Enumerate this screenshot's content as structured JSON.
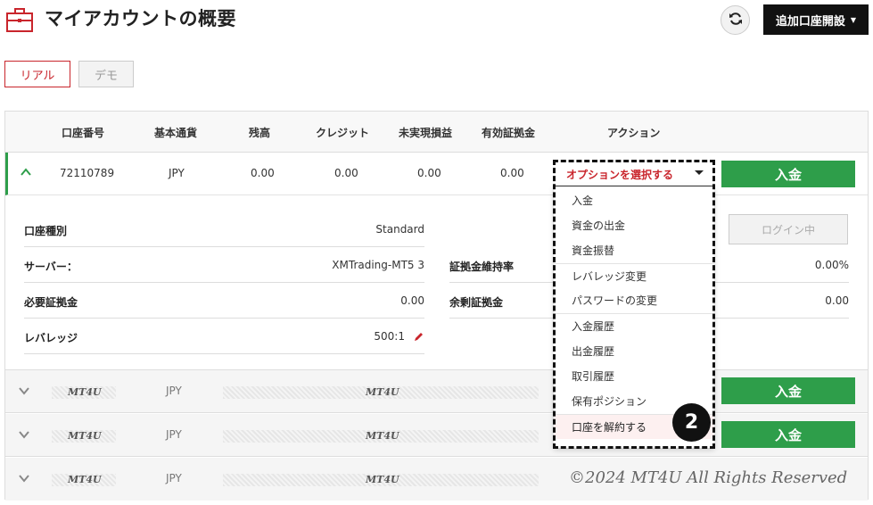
{
  "header": {
    "title": "マイアカウントの概要",
    "add_account_label": "追加口座開設",
    "colors": {
      "accent_red": "#c9252c",
      "dark": "#111111",
      "green": "#2e9e4a"
    }
  },
  "mode_tabs": [
    {
      "label": "リアル",
      "active": true
    },
    {
      "label": "デモ",
      "active": false
    }
  ],
  "table": {
    "columns": [
      "口座番号",
      "基本通貨",
      "残高",
      "クレジット",
      "未実現損益",
      "有効証拠金",
      "アクション"
    ],
    "main_row": {
      "account_number": "72110789",
      "currency": "JPY",
      "balance": "0.00",
      "credit": "0.00",
      "unrealized_pl": "0.00",
      "equity": "0.00",
      "action_select": "オプションを選択する",
      "deposit_label": "入金"
    },
    "details": {
      "account_type_label": "口座種別",
      "account_type_value": "Standard",
      "server_label": "サーバー：",
      "server_value": "XMTrading-MT5 3",
      "required_margin_label": "必要証拠金",
      "required_margin_value": "0.00",
      "leverage_label": "レバレッジ",
      "leverage_value": "500:1",
      "margin_level_label": "証拠金維持率",
      "margin_level_value": "0.00%",
      "free_margin_label": "余剰証拠金",
      "free_margin_value": "0.00",
      "login_label": "ログイン中"
    },
    "collapsed_rows": [
      {
        "wm1": "MT4U",
        "currency": "JPY",
        "wm2": "MT4U",
        "deposit_label": "入金",
        "show_deposit": true
      },
      {
        "wm1": "MT4U",
        "currency": "JPY",
        "wm2": "MT4U",
        "deposit_label": "入金",
        "show_deposit": true
      },
      {
        "wm1": "MT4U",
        "currency": "JPY",
        "wm2": "MT4U",
        "deposit_label": "",
        "show_deposit": false
      }
    ]
  },
  "dropdown_menu": {
    "items": [
      "入金",
      "資金の出金",
      "資金振替",
      "レバレッジ変更",
      "パスワードの変更",
      "入金履歴",
      "出金履歴",
      "取引履歴",
      "保有ポジション",
      "口座を解約する"
    ],
    "highlighted_index": 9
  },
  "annotation": {
    "badge": "2"
  },
  "footer": {
    "watermark": "©2024 MT4U All Rights Reserved"
  }
}
